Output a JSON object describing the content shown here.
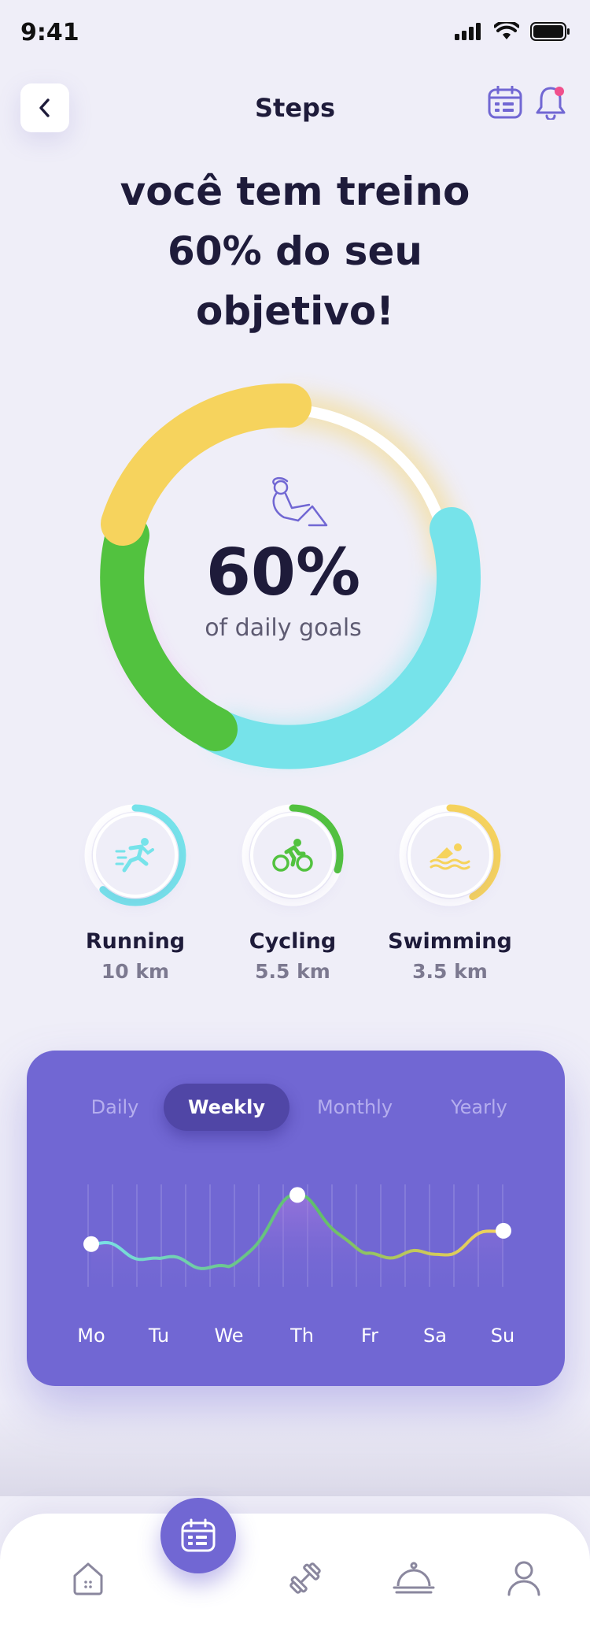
{
  "status_bar": {
    "time": "9:41"
  },
  "header": {
    "title": "Steps"
  },
  "headline": [
    "você tem treino",
    "60% do seu",
    "objetivo!"
  ],
  "goal": {
    "percent_label": "60%",
    "subtitle": "of daily goals",
    "progress": 0.6,
    "ring_colors": {
      "running": "#76E3EA",
      "cycling": "#52C23F",
      "swimming": "#F6D35D",
      "track": "#FFFFFF"
    }
  },
  "activities": [
    {
      "name": "Running",
      "distance": "10 km",
      "color": "#76E3EA",
      "progress": 0.62,
      "icon": "running-icon"
    },
    {
      "name": "Cycling",
      "distance": "5.5 km",
      "color": "#52C23F",
      "progress": 0.3,
      "icon": "cycling-icon"
    },
    {
      "name": "Swimming",
      "distance": "3.5 km",
      "color": "#F6D35D",
      "progress": 0.42,
      "icon": "swimming-icon"
    }
  ],
  "stats": {
    "tabs": [
      "Daily",
      "Weekly",
      "Monthly",
      "Yearly"
    ],
    "active_tab": "Weekly",
    "days": [
      "Mo",
      "Tu",
      "We",
      "Th",
      "Fr",
      "Sa",
      "Su"
    ],
    "card_color": "#7167D3"
  },
  "chart_data": {
    "type": "line",
    "x": [
      "Mo",
      "Tu",
      "We",
      "Th",
      "Fr",
      "Sa",
      "Su"
    ],
    "series": [
      {
        "values": [
          0.34,
          0.2,
          0.12,
          0.82,
          0.25,
          0.24,
          0.47
        ]
      }
    ],
    "highlighted_points": [
      "Mo",
      "Th",
      "Su"
    ],
    "ylim": [
      0,
      1
    ],
    "grid": true
  },
  "tabbar": {
    "items": [
      "home-icon",
      "calendar-icon",
      "dumbbell-icon",
      "food-cloche-icon",
      "profile-icon"
    ],
    "active": "calendar-icon"
  }
}
